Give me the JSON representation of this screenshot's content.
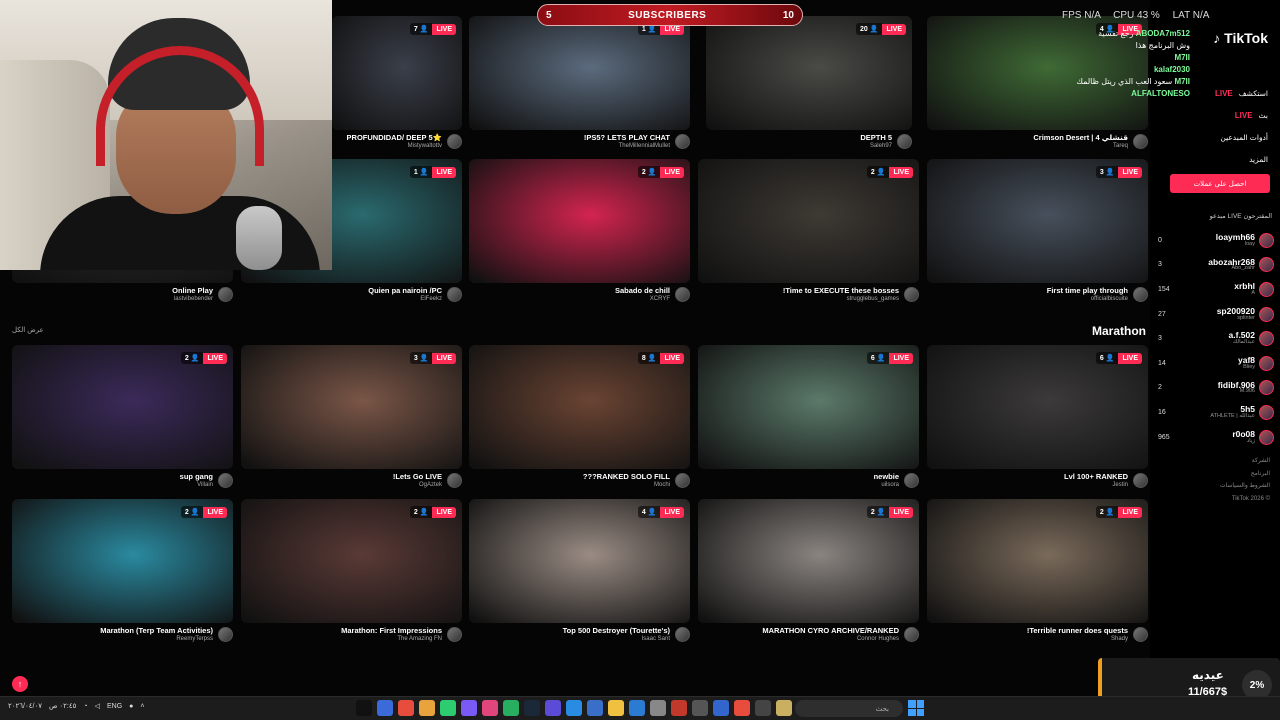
{
  "overlay": {
    "subscribers": {
      "label": "SUBSCRIBERS",
      "current": "5",
      "goal": "10"
    },
    "osd": {
      "fps": "FPS N/A",
      "cpu": "CPU 43 %",
      "lat": "LAT N/A"
    },
    "chat": [
      {
        "name": "ABODA7m512",
        "msg": "رجع تفسية"
      },
      {
        "name": "",
        "msg": "وش البرنامج هذا"
      },
      {
        "name": "M7II",
        "msg": ""
      },
      {
        "name": "kalaf2030",
        "msg": ""
      },
      {
        "name": "M7II",
        "msg": "سعود العب الذي ريتل ظالمك"
      },
      {
        "name": "ALFALTONESO",
        "msg": ""
      }
    ],
    "donation": {
      "label": "عيديه",
      "amount": "11/667$",
      "percent": "2%"
    }
  },
  "sidebar": {
    "logo": "TikTok",
    "nav": [
      {
        "label": "استكشف",
        "badge": "LIVE",
        "type": "live"
      },
      {
        "label": "بث",
        "badge": "LIVE",
        "type": "live2"
      },
      {
        "label": "أدوات المبدعين",
        "badge": "",
        "type": ""
      },
      {
        "label": "المزيد",
        "badge": "",
        "type": ""
      }
    ],
    "coins_button": "احصل على عملات",
    "suggested_heading": "مبدعو LIVE المقترحون",
    "creators": [
      {
        "rank": "0",
        "name": "loaymh66",
        "sub": "loay"
      },
      {
        "rank": "3",
        "name": "abozahr268",
        "sub": "Abo_zahr"
      },
      {
        "rank": "154",
        "name": "xrbhl",
        "sub": "A"
      },
      {
        "rank": "27",
        "name": "sp200920",
        "sub": "splinter"
      },
      {
        "rank": "3",
        "name": "a.f.502",
        "sub": "عبدالمالك"
      },
      {
        "rank": "14",
        "name": "yaf8",
        "sub": "Bliey"
      },
      {
        "rank": "2",
        "name": "fidibf.906",
        "sub": "M.906"
      },
      {
        "rank": "16",
        "name": "5h5",
        "sub": "ATHLETE | عبدالله"
      },
      {
        "rank": "965",
        "name": "r0o08",
        "sub": "زياد"
      }
    ],
    "footer": [
      "الشركة",
      "البرنامج",
      "الشروط والسياسات",
      "TikTok 2026 ©"
    ]
  },
  "grid": {
    "section_title": "Marathon",
    "see_all": "عرض الكل",
    "row1": [
      {
        "title": "PROFUNDIDAD/ DEEP 5⭐",
        "user": "Mistywaltottv",
        "viewers": "7",
        "color": "#3a3f4a"
      },
      {
        "title": "!PS5? LETS PLAY CHAT",
        "user": "TheMillennialMullet",
        "viewers": "1",
        "color": "#5b6b7e"
      },
      {
        "title": "DEPTH 5",
        "user": "Saleh97",
        "viewers": "20",
        "color": "#4a4a46"
      },
      {
        "title": "Crimson Desert | قنشلي 4",
        "user": "Tareq",
        "viewers": "4",
        "color": "#3f6a35"
      }
    ],
    "row2": [
      {
        "title": "Online Play",
        "user": "lastvibebender",
        "viewers": "",
        "color": "#2a2a2a"
      },
      {
        "title": "Quien pa nairoin /PC",
        "user": "ElFeekz",
        "viewers": "1",
        "color": "#2a6a6f"
      },
      {
        "title": "Sabado de chill",
        "user": "XCRYF",
        "viewers": "2",
        "color": "#d3244f"
      },
      {
        "title": "!Time to EXECUTE these bosses",
        "user": "strugglebus_games",
        "viewers": "2",
        "color": "#3e3a34"
      },
      {
        "title": "First time play through",
        "user": "officialbiscuite",
        "viewers": "3",
        "color": "#47505c"
      }
    ],
    "row3": [
      {
        "title": "sup gang",
        "user": "Villain",
        "viewers": "2",
        "color": "#3b2a5a"
      },
      {
        "title": "!Lets Go LIVE",
        "user": "OgAztek",
        "viewers": "3",
        "color": "#7a5647"
      },
      {
        "title": "???RANKED SOLO FILL",
        "user": "Mochi",
        "viewers": "8",
        "color": "#6a4433"
      },
      {
        "title": "newbie",
        "user": "uilsora",
        "viewers": "6",
        "color": "#5b7a6a"
      },
      {
        "title": "Lvl 100+ RANKED",
        "user": "Jestin",
        "viewers": "6",
        "color": "#3c3a3a"
      }
    ],
    "row4": [
      {
        "title": "Marathon (Terp Team Activities)",
        "user": "ReemyTerpss",
        "viewers": "2",
        "color": "#2a8aa0"
      },
      {
        "title": "Marathon: First Impressions",
        "user": "The Amazing FN",
        "viewers": "2",
        "color": "#5a3a36"
      },
      {
        "title": "Top 500 Destroyer (Tourette's)",
        "user": "Isaac Sant",
        "viewers": "4",
        "color": "#9a8c84"
      },
      {
        "title": "MARATHON CYRO ARCHIVE/RANKED",
        "user": "Connor Hughes",
        "viewers": "2",
        "color": "#8a8480"
      },
      {
        "title": "!Terrible runner does quests",
        "user": "Shady",
        "viewers": "2",
        "color": "#7a6a5a"
      }
    ],
    "live_label": "LIVE"
  },
  "taskbar": {
    "lang": "ENG",
    "time": "٠٢:٤٥ ص",
    "date": "٢٠٢٦/٠٤/٠٧",
    "search": "بحث"
  }
}
